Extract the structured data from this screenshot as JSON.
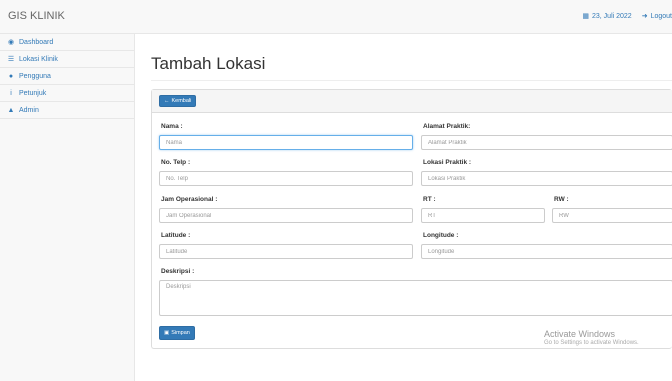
{
  "brand": "GIS KLINIK",
  "topbar": {
    "date": "23, Juli 2022",
    "logout": "Logout"
  },
  "sidebar": {
    "items": [
      {
        "label": "Dashboard",
        "icon": "dashboard-icon"
      },
      {
        "label": "Lokasi Klinik",
        "icon": "table-icon"
      },
      {
        "label": "Pengguna",
        "icon": "users-icon"
      },
      {
        "label": "Petunjuk",
        "icon": "info-icon"
      },
      {
        "label": "Admin",
        "icon": "user-icon"
      }
    ]
  },
  "page": {
    "title": "Tambah Lokasi"
  },
  "form": {
    "back_label": "Kembali",
    "nama": {
      "label": "Nama :",
      "placeholder": "Nama"
    },
    "alamat": {
      "label": "Alamat Praktik:",
      "placeholder": "Alamat Praktik"
    },
    "telp": {
      "label": "No. Telp :",
      "placeholder": "No. Telp"
    },
    "lokasi": {
      "label": "Lokasi Praktik :",
      "placeholder": "Lokasi Praktik"
    },
    "jam": {
      "label": "Jam Operasional :",
      "placeholder": "Jam Operasional"
    },
    "rt": {
      "label": "RT :",
      "placeholder": "RT"
    },
    "rw": {
      "label": "RW :",
      "placeholder": "RW"
    },
    "latitude": {
      "label": "Latitude :",
      "placeholder": "Latitude"
    },
    "longitude": {
      "label": "Longitude :",
      "placeholder": "Longitude"
    },
    "deskripsi": {
      "label": "Deskripsi :",
      "placeholder": "Deskripsi"
    },
    "save_label": "Simpan"
  },
  "watermark": {
    "title": "Activate Windows",
    "subtitle": "Go to Settings to activate Windows."
  },
  "colors": {
    "primary": "#337ab7",
    "sidebar_bg": "#f8f8f8",
    "border": "#e7e7e7"
  }
}
